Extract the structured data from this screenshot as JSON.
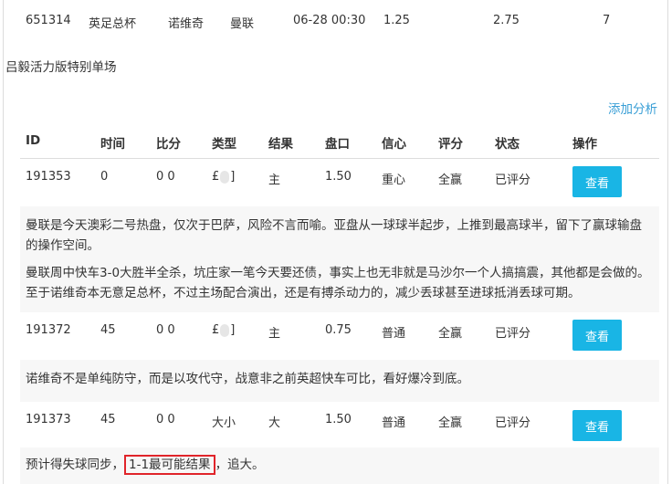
{
  "top_match": {
    "id": "651314",
    "league": "英足总杯",
    "home": "诺维奇",
    "away": "曼联",
    "datetime": "06-28 00:30",
    "odds_home": "1.25",
    "odds_mid": "2.75",
    "odds_away": "7"
  },
  "site_title": "吕毅活力版特别单场",
  "add_analysis_label": "添加分析",
  "headers": [
    "ID",
    "时间",
    "比分",
    "类型",
    "结果",
    "盘口",
    "信心",
    "评分",
    "状态",
    "操作"
  ],
  "rows": [
    {
      "id": "191353",
      "time": "0",
      "score": "0 0",
      "type_prefix": "£",
      "type_suffix": "]",
      "result": "主",
      "line": "1.50",
      "confidence": "重心",
      "rating": "全赢",
      "status": "已评分",
      "action": "查看",
      "analysis": [
        "曼联是今天澳彩二号热盘，仅次于巴萨，风险不言而喻。亚盘从一球球半起步，上推到最高球半，留下了赢球输盘的操作空间。",
        "曼联周中快车3-0大胜半全杀，坑庄家一笔今天要还债，事实上也无非就是马沙尔一个人搞搞震，其他都是会做的。至于诺维奇本无意足总杯，不过主场配合演出，还是有搏杀动力的，减少丢球甚至进球抵消丢球可期。"
      ]
    },
    {
      "id": "191372",
      "time": "45",
      "score": "0 0",
      "type_prefix": "£",
      "type_suffix": "]",
      "result": "主",
      "line": "0.75",
      "confidence": "普通",
      "rating": "全赢",
      "status": "已评分",
      "action": "查看",
      "analysis": [
        "诺维奇不是单纯防守，而是以攻代守，战意非之前英超快车可比，看好爆冷到底。"
      ]
    },
    {
      "id": "191373",
      "time": "45",
      "score": "0 0",
      "type": "大小",
      "result": "大",
      "line": "1.50",
      "confidence": "普通",
      "rating": "全赢",
      "status": "已评分",
      "action": "查看",
      "analysis_before": "预计得失球同步，",
      "analysis_highlight": "1-1最可能结果",
      "analysis_after": "，追大。"
    }
  ],
  "colors": {
    "button_bg": "#19b5e5",
    "link": "#3a9fd6",
    "highlight_border": "#e0242a",
    "analysis_bg": "#f7f7f7"
  }
}
